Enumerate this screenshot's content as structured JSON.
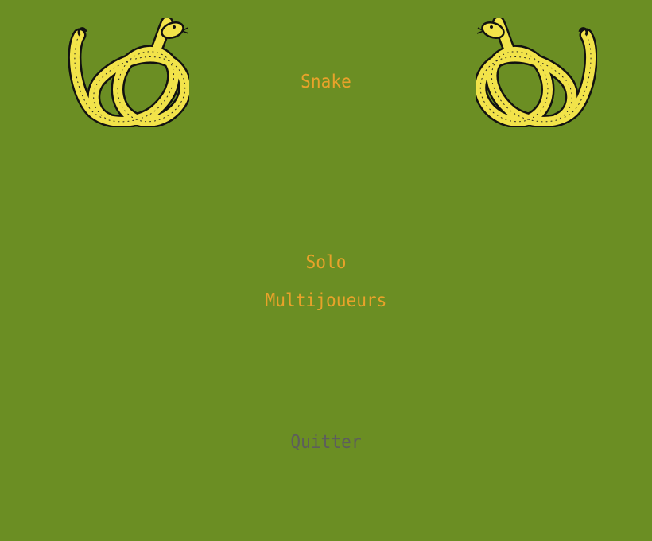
{
  "title": "Snake",
  "menu": {
    "solo": "Solo",
    "multiplayer": "Multijoueurs",
    "quit": "Quitter"
  },
  "colors": {
    "background": "#6b8e23",
    "menu_text": "#e8a22a",
    "quit_text": "#5d5d5d",
    "snake_body": "#f2e34a"
  },
  "decorations": [
    "coiled-snake-icon",
    "coiled-snake-icon"
  ]
}
